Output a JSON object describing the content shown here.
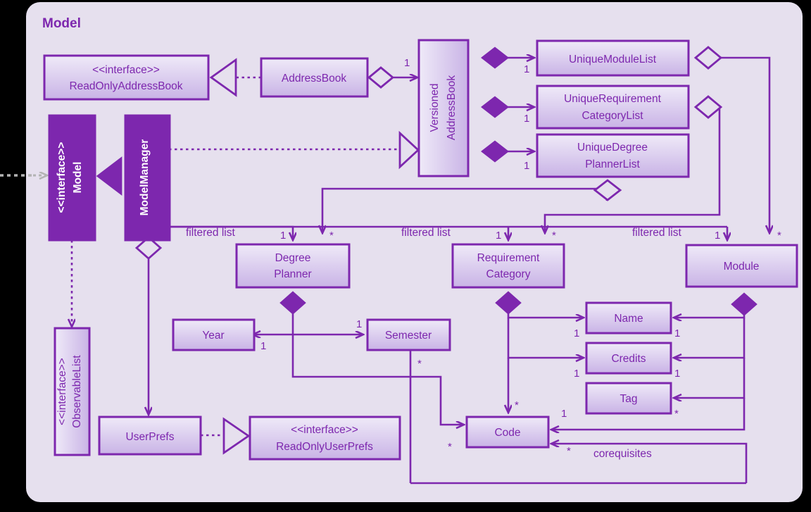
{
  "panel": {
    "title": "Model",
    "background": "#e6e0ee",
    "accent": "#7d27ae",
    "box_fill_top": "#ece7f6",
    "box_fill_bottom": "#cbb6e6",
    "solid_fill": "#7d27ae"
  },
  "classes": {
    "read_only_address_book": {
      "stereotype": "<<interface>>",
      "name": "ReadOnlyAddressBook"
    },
    "address_book": {
      "name": "AddressBook"
    },
    "versioned_address_book": {
      "line1": "Versioned",
      "line2": "AddressBook"
    },
    "unique_module_list": {
      "name": "UniqueModuleList"
    },
    "unique_requirement_category_list": {
      "line1": "UniqueRequirement",
      "line2": "CategoryList"
    },
    "unique_degree_planner_list": {
      "line1": "UniqueDegree",
      "line2": "PlannerList"
    },
    "model": {
      "stereotype": "<<interface>>",
      "name": "Model"
    },
    "model_manager": {
      "name": "ModelManager"
    },
    "observable_list": {
      "stereotype": "<<interface>>",
      "name": "ObservableList"
    },
    "user_prefs": {
      "name": "UserPrefs"
    },
    "read_only_user_prefs": {
      "stereotype": "<<interface>>",
      "name": "ReadOnlyUserPrefs"
    },
    "degree_planner": {
      "line1": "Degree",
      "line2": "Planner"
    },
    "requirement_category": {
      "line1": "Requirement",
      "line2": "Category"
    },
    "module": {
      "name": "Module"
    },
    "year": {
      "name": "Year"
    },
    "semester": {
      "name": "Semester"
    },
    "name_class": {
      "name": "Name"
    },
    "credits": {
      "name": "Credits"
    },
    "tag": {
      "name": "Tag"
    },
    "code": {
      "name": "Code"
    }
  },
  "edge_labels": {
    "filtered_list_1": "filtered list",
    "filtered_list_2": "filtered list",
    "filtered_list_3": "filtered list",
    "corequisites": "corequisites"
  },
  "multiplicities": {
    "ab_to_vab": "1",
    "vab_to_uml": "1",
    "vab_to_urcl": "1",
    "vab_to_udpl": "1",
    "dp_one": "1",
    "dp_star": "*",
    "rc_one": "1",
    "rc_star": "*",
    "mod_one": "1",
    "mod_star": "*",
    "year_one_left": "1",
    "semester_one": "1",
    "semester_star": "*",
    "rc_name_one": "1",
    "rc_credits_one": "1",
    "mod_name_one": "1",
    "mod_credits_one": "1",
    "mod_tag_star": "*",
    "rc_code_star": "*",
    "code_in_star": "*",
    "code_one": "1",
    "code_coreq_star": "*",
    "dp_code_star": "*"
  }
}
